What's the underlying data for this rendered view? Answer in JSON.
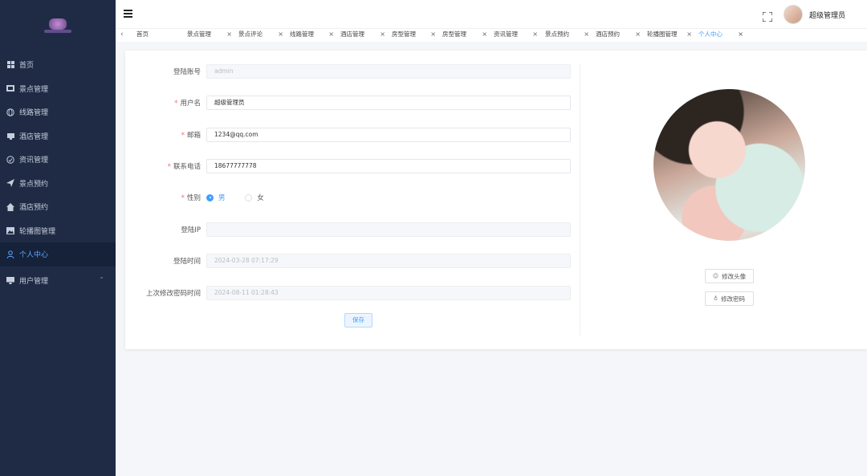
{
  "sidebar": {
    "items": [
      {
        "label": "首页",
        "icon": "grid-icon"
      },
      {
        "label": "景点管理",
        "icon": "scenic-icon"
      },
      {
        "label": "线路管理",
        "icon": "globe-icon"
      },
      {
        "label": "酒店管理",
        "icon": "hotel-icon"
      },
      {
        "label": "资讯管理",
        "icon": "news-icon"
      },
      {
        "label": "景点预约",
        "icon": "send-icon"
      },
      {
        "label": "酒店预约",
        "icon": "home-icon"
      },
      {
        "label": "轮播图管理",
        "icon": "image-icon"
      },
      {
        "label": "个人中心",
        "icon": "user-icon",
        "active": true
      },
      {
        "label": "用户管理",
        "icon": "monitor-icon"
      }
    ]
  },
  "header": {
    "user_name": "超级管理员"
  },
  "tabs": [
    {
      "label": "首页"
    },
    {
      "label": "景点管理"
    },
    {
      "label": "景点评论"
    },
    {
      "label": "线路管理"
    },
    {
      "label": "酒店管理"
    },
    {
      "label": "房型管理"
    },
    {
      "label": "房型管理"
    },
    {
      "label": "资讯管理"
    },
    {
      "label": "景点预约"
    },
    {
      "label": "酒店预约"
    },
    {
      "label": "轮播图管理"
    },
    {
      "label": "个人中心",
      "active": true
    }
  ],
  "form": {
    "account": {
      "label": "登陆账号",
      "value": "admin"
    },
    "username": {
      "label": "用户名",
      "value": "超级管理员"
    },
    "email": {
      "label": "邮箱",
      "value": "1234@qq.com"
    },
    "phone": {
      "label": "联系电话",
      "value": "18677777778"
    },
    "gender": {
      "label": "性别",
      "options": [
        "男",
        "女"
      ],
      "selected": "男"
    },
    "login_ip": {
      "label": "登陆IP",
      "value": ""
    },
    "login_time": {
      "label": "登陆时间",
      "value": "2024-03-28 07:17:29"
    },
    "pwd_time": {
      "label": "上次修改密码时间",
      "value": "2024-08-11 01:28:43"
    },
    "save_label": "保存"
  },
  "profile": {
    "change_avatar": "修改头像",
    "change_password": "修改密码"
  },
  "colors": {
    "sidebar_bg": "#1f2b45",
    "accent": "#409eff",
    "required": "#f56c6c"
  }
}
